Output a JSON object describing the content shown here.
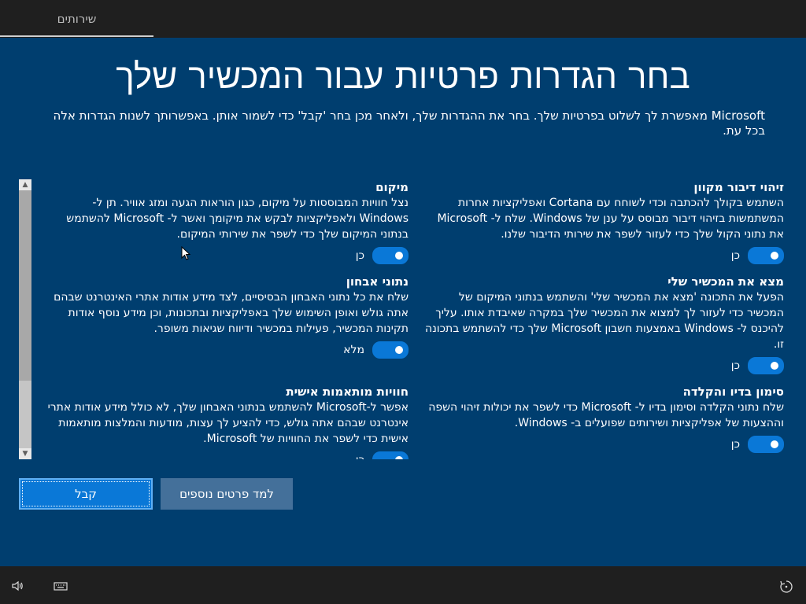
{
  "topbar": {
    "tab_label": "שירותים"
  },
  "page": {
    "title": "בחר הגדרות פרטיות עבור המכשיר שלך",
    "subtitle": "Microsoft מאפשרת לך לשלוט בפרטיות שלך. בחר את ההגדרות שלך, ולאחר מכן בחר 'קבל' כדי לשמור אותן. באפשרותך לשנות הגדרות אלה בכל עת."
  },
  "settings": [
    {
      "title": "זיהוי דיבור מקוון",
      "desc": "השתמש בקולך להכתבה וכדי לשוחח עם Cortana ואפליקציות אחרות המשתמשות בזיהוי דיבור מבוסס על ענן של Windows. שלח ל- Microsoft את נתוני הקול שלך כדי לעזור לשפר את שירותי הדיבור שלנו.",
      "toggle_label": "כן"
    },
    {
      "title": "מיקום",
      "desc": "נצל חוויות המבוססות על מיקום, כגון הוראות הגעה ומזג אוויר. תן ל- Windows ולאפליקציות לבקש את מיקומך ואשר ל- Microsoft להשתמש בנתוני המיקום שלך כדי לשפר את שירותי המיקום.",
      "toggle_label": "כן"
    },
    {
      "title": "מצא את המכשיר שלי",
      "desc": "הפעל את התכונה 'מצא את המכשיר שלי' והשתמש בנתוני המיקום של המכשיר כדי לעזור לך למצוא את המכשיר שלך במקרה שאיבדת אותו. עליך להיכנס ל- Windows באמצעות חשבון Microsoft שלך כדי להשתמש בתכונה זו.",
      "toggle_label": "כן"
    },
    {
      "title": "נתוני אבחון",
      "desc": "שלח את כל נתוני האבחון הבסיסיים, לצד מידע אודות אתרי האינטרנט שבהם אתה גולש ואופן השימוש שלך באפליקציות ובתכונות, וכן מידע נוסף אודות תקינות המכשיר, פעילות במכשיר ודיווח שגיאות משופר.",
      "toggle_label": "מלא"
    },
    {
      "title": "סימון בדיו והקלדה",
      "desc": "שלח נתוני הקלדה וסימון בדיו ל- Microsoft כדי לשפר את יכולות זיהוי השפה וההצעות של אפליקציות ושירותים שפועלים ב- Windows.",
      "toggle_label": "כן"
    },
    {
      "title": "חוויות מותאמות אישית",
      "desc": "אפשר ל-Microsoft להשתמש בנתוני האבחון שלך, לא כולל מידע אודות אתרי אינטרנט שבהם אתה גולש, כדי להציע לך עצות, מודעות והמלצות מותאמות אישית כדי לשפר את החוויות של Microsoft.",
      "toggle_label": "כן"
    }
  ],
  "buttons": {
    "accept": "קבל",
    "learn_more": "למד פרטים נוספים"
  },
  "icons": {
    "volume": "volume-icon",
    "keyboard": "keyboard-icon",
    "accessibility": "ease-of-access-icon"
  },
  "colors": {
    "background": "#003e6f",
    "accent": "#0a78d7",
    "bar": "#1f1f1f"
  }
}
